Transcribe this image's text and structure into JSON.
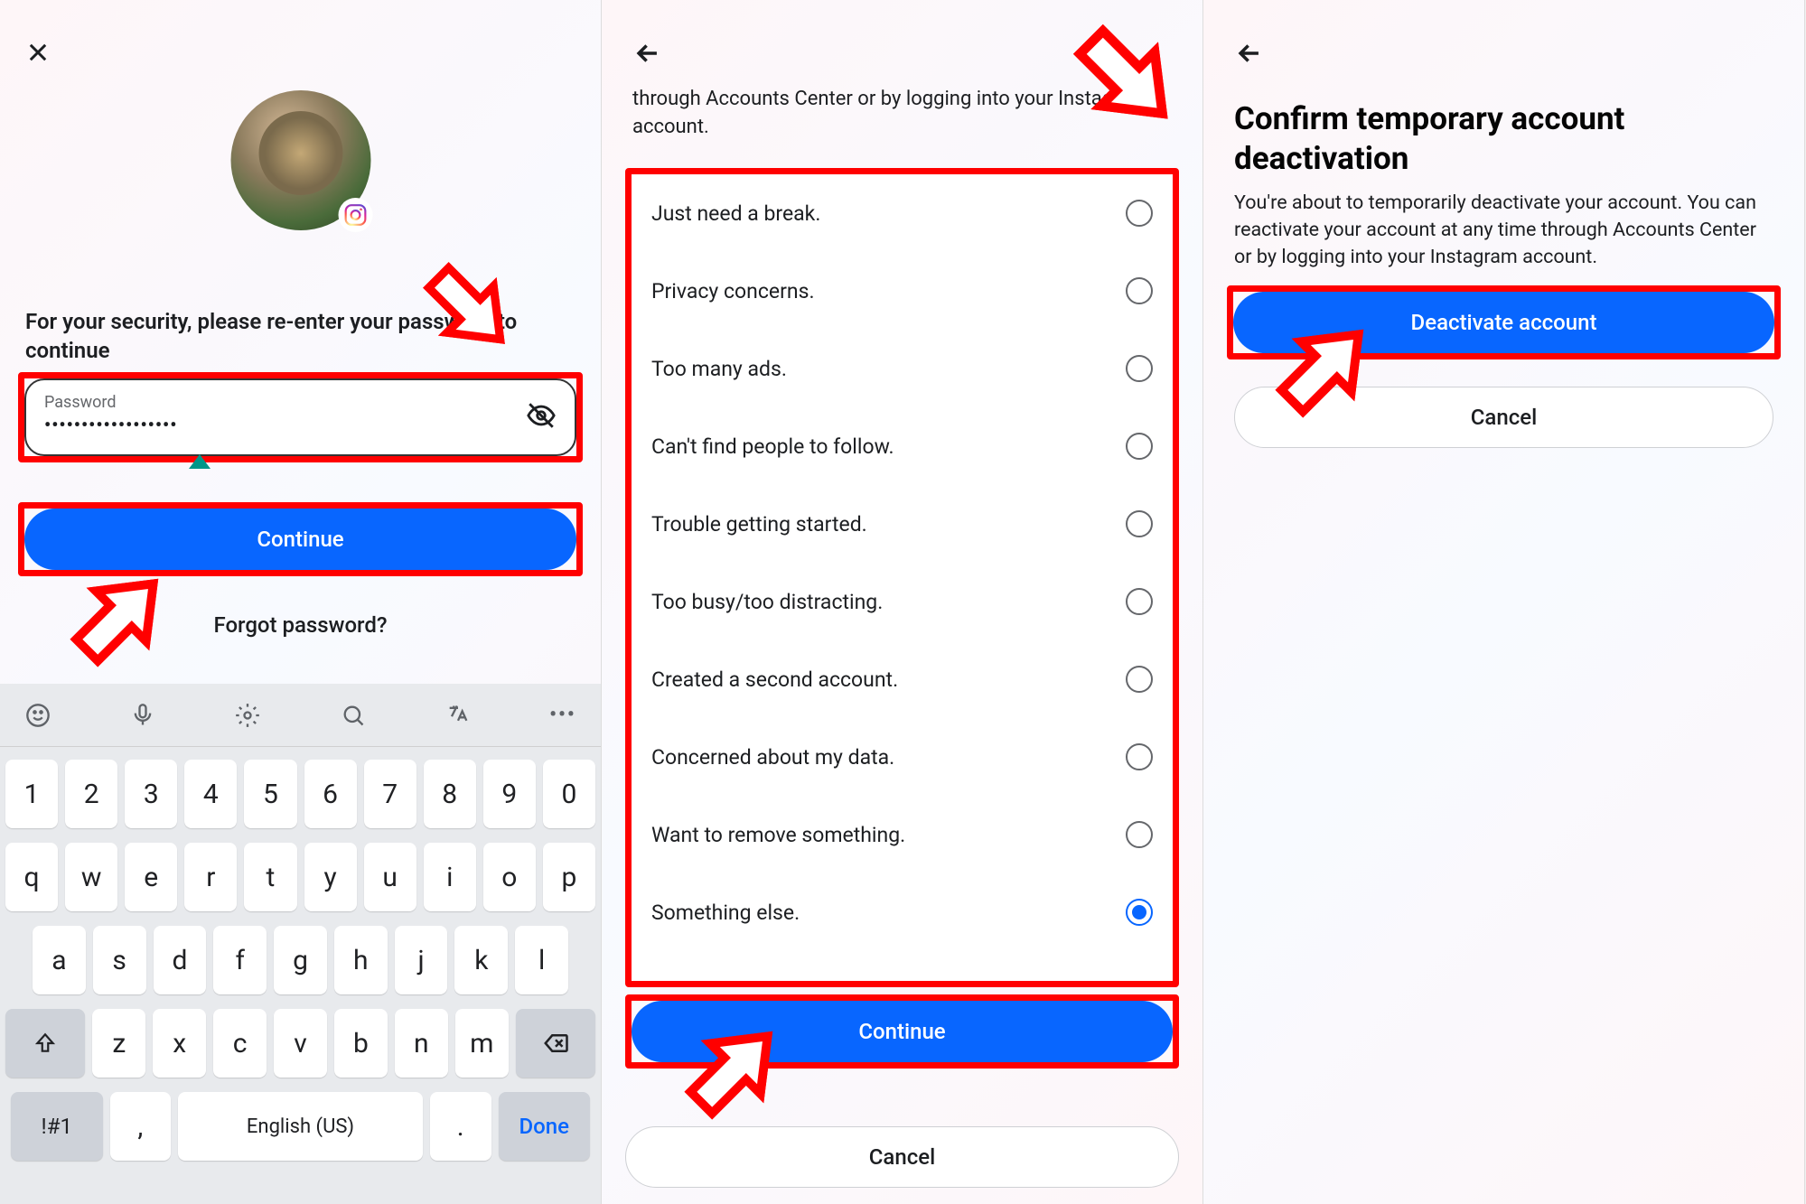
{
  "screen1": {
    "security_prompt": "For your security, please re-enter your password to continue",
    "password_label": "Password",
    "password_value": "••••••••••••••••••",
    "continue_label": "Continue",
    "forgot_label": "Forgot password?"
  },
  "screen2": {
    "header_fragment": "through Accounts Center or by logging into your Instagram account.",
    "reasons": [
      "Just need a break.",
      "Privacy concerns.",
      "Too many ads.",
      "Can't find people to follow.",
      "Trouble getting started.",
      "Too busy/too distracting.",
      "Created a second account.",
      "Concerned about my data.",
      "Want to remove something.",
      "Something else."
    ],
    "selected_index": 9,
    "continue_label": "Continue",
    "cancel_label": "Cancel"
  },
  "screen3": {
    "title": "Confirm temporary account deactivation",
    "description": "You're about to temporarily deactivate your account. You can reactivate your account at any time through Accounts Center or by logging into your Instagram account.",
    "deactivate_label": "Deactivate account",
    "cancel_label": "Cancel"
  },
  "keyboard": {
    "row_num": [
      "1",
      "2",
      "3",
      "4",
      "5",
      "6",
      "7",
      "8",
      "9",
      "0"
    ],
    "row1": [
      "q",
      "w",
      "e",
      "r",
      "t",
      "y",
      "u",
      "i",
      "o",
      "p"
    ],
    "row2": [
      "a",
      "s",
      "d",
      "f",
      "g",
      "h",
      "j",
      "k",
      "l"
    ],
    "row3": [
      "z",
      "x",
      "c",
      "v",
      "b",
      "n",
      "m"
    ],
    "sym_label": "!#1",
    "comma": ",",
    "space_label": "English (US)",
    "period": ".",
    "done_label": "Done"
  }
}
